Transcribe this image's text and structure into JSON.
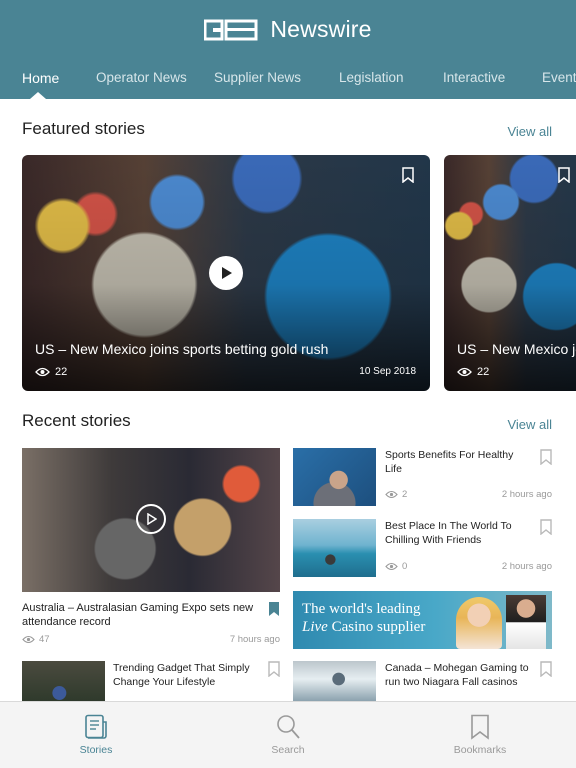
{
  "header": {
    "brand": "Newswire",
    "logo_text": "GB",
    "nav": [
      {
        "label": "Home",
        "active": true
      },
      {
        "label": "Operator News"
      },
      {
        "label": "Supplier News"
      },
      {
        "label": "Legislation"
      },
      {
        "label": "Interactive"
      },
      {
        "label": "Event"
      }
    ]
  },
  "featured": {
    "title": "Featured stories",
    "view_all": "View all",
    "cards": [
      {
        "title": "US – New Mexico joins sports betting gold rush",
        "views": "22",
        "date": "10 Sep 2018"
      },
      {
        "title": "US – New Mexico jo",
        "views": "22"
      }
    ]
  },
  "recent": {
    "title": "Recent stories",
    "view_all": "View all",
    "big": {
      "title": "Australia – Australasian Gaming Expo sets new attendance record",
      "views": "47",
      "time": "7 hours ago"
    },
    "right": [
      {
        "title": "Sports Benefits For Healthy Life",
        "views": "2",
        "time": "2 hours ago"
      },
      {
        "title": "Best Place In The World To Chilling With Friends",
        "views": "0",
        "time": "2 hours ago"
      },
      {
        "title": "Canada – Mohegan Gaming to run two Niagara Fall casinos"
      }
    ],
    "left_more": {
      "title": "Trending Gadget That Simply Change Your Lifestyle"
    },
    "ad": {
      "line1": "The world's leading",
      "line2_italic": "Live",
      "line2_rest": " Casino supplier"
    }
  },
  "tabbar": [
    {
      "label": "Stories",
      "icon": "stories-icon",
      "active": true
    },
    {
      "label": "Search",
      "icon": "search-icon"
    },
    {
      "label": "Bookmarks",
      "icon": "bookmark-icon"
    }
  ],
  "colors": {
    "accent": "#4a8494",
    "muted": "#9a9a9a",
    "tab_bg": "#f4f4f4"
  }
}
